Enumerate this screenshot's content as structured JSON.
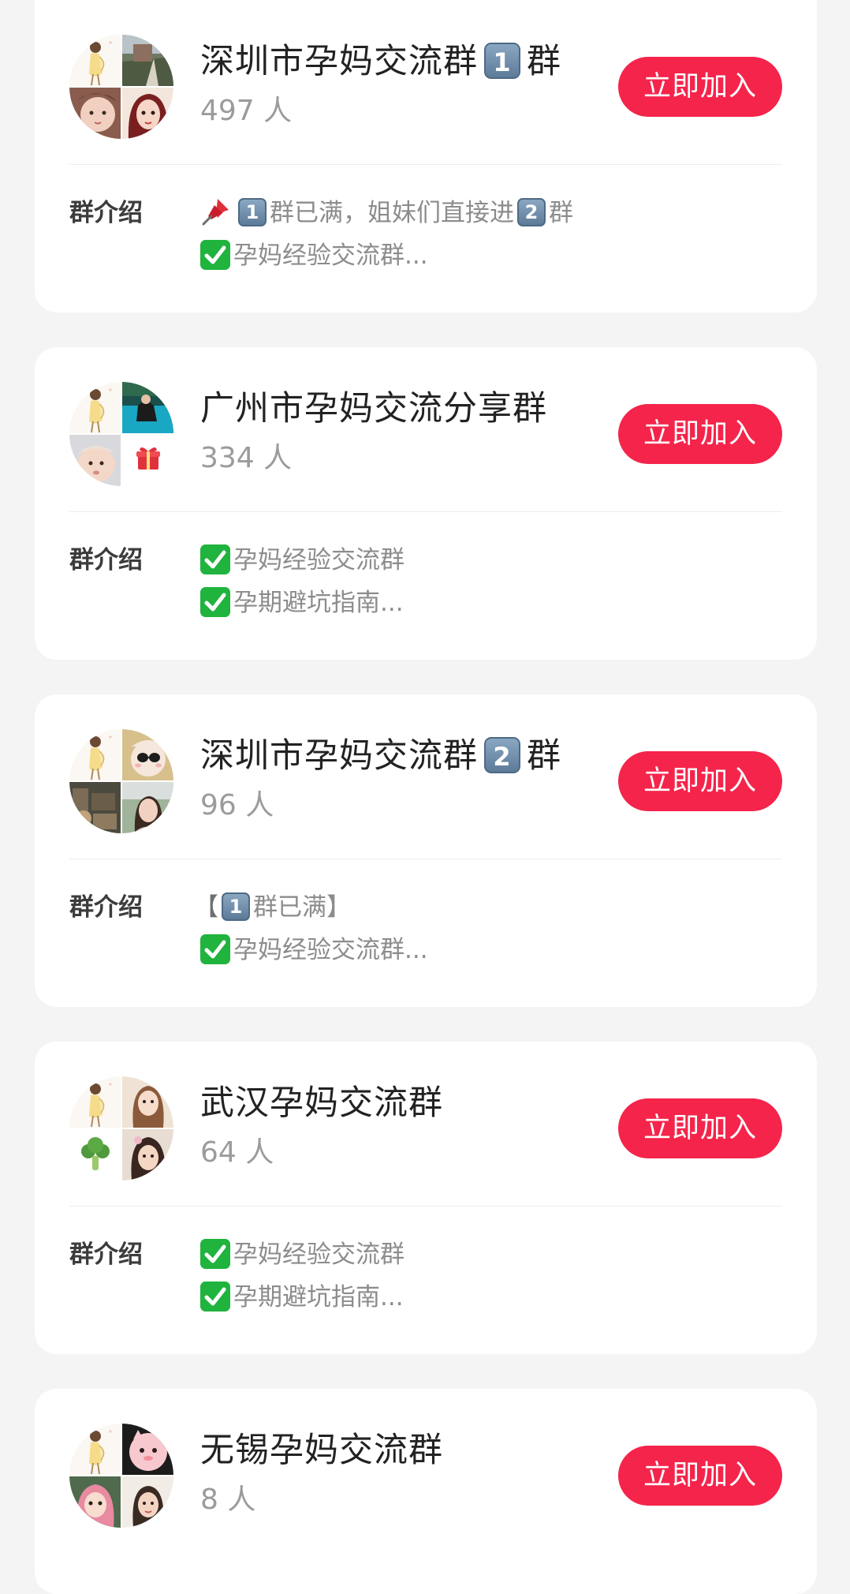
{
  "groups": [
    {
      "name_before": "深圳市孕妈交流群",
      "name_badge": "1",
      "name_after": "群",
      "member_count": "497 人",
      "join_label": "立即加入",
      "intro_label": "群介绍",
      "intro_line1_badge_a": "1",
      "intro_line1_text_a": "群已满，姐妹们直接进",
      "intro_line1_badge_b": "2",
      "intro_line1_text_b": "群",
      "intro_line2": "孕妈经验交流群..."
    },
    {
      "name": "广州市孕妈交流分享群",
      "member_count": "334 人",
      "join_label": "立即加入",
      "intro_label": "群介绍",
      "intro_line1": "孕妈经验交流群",
      "intro_line2": "孕期避坑指南..."
    },
    {
      "name_before": "深圳市孕妈交流群",
      "name_badge": "2",
      "name_after": "群",
      "member_count": "96 人",
      "join_label": "立即加入",
      "intro_label": "群介绍",
      "intro_line1_open": "【",
      "intro_line1_badge": "1",
      "intro_line1_text": "群已满】",
      "intro_line2": "孕妈经验交流群..."
    },
    {
      "name": "武汉孕妈交流群",
      "member_count": "64 人",
      "join_label": "立即加入",
      "intro_label": "群介绍",
      "intro_line1": "孕妈经验交流群",
      "intro_line2": "孕期避坑指南..."
    },
    {
      "name": "无锡孕妈交流群",
      "member_count": "8 人",
      "join_label": "立即加入"
    }
  ],
  "colors": {
    "page_background": "#f4f4f4",
    "card_background": "#ffffff",
    "join_button": "#f5244b",
    "title_text": "#222222",
    "secondary_text": "#9b9b9b",
    "check_green": "#20b33e",
    "number_badge": "#6f8cab"
  },
  "icons": {
    "number_badge": "keycap-number-icon",
    "check": "check-mark-button-icon",
    "pin": "pushpin-icon",
    "gift": "gift-icon",
    "broccoli": "broccoli-icon"
  }
}
